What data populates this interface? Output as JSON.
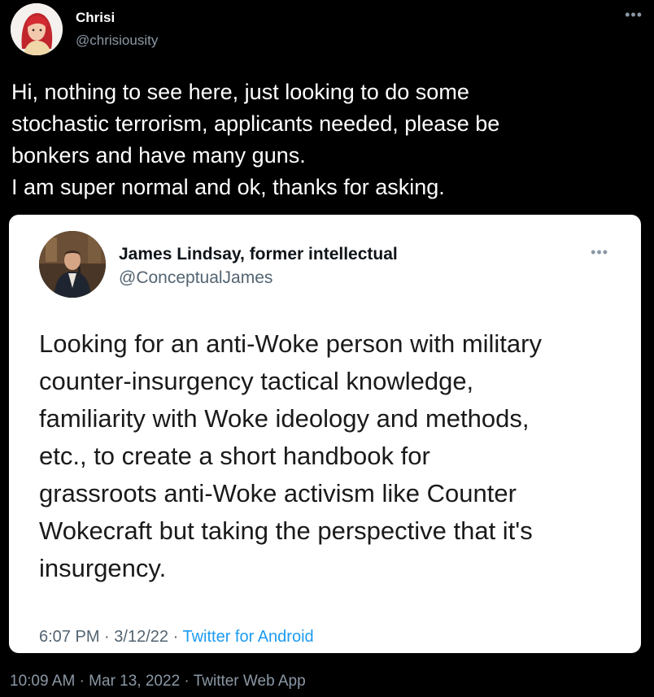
{
  "tweet": {
    "author_name": "Chrisi",
    "author_handle": "@chrisiousity",
    "text_lines": [
      "Hi, nothing to see here, just looking to do some",
      "stochastic terrorism, applicants needed, please be",
      "bonkers and have many guns.",
      "I am super normal and ok, thanks for asking."
    ],
    "more_icon": "more-dots-icon",
    "time": "10:09 AM",
    "separator": "·",
    "date": "Mar 13, 2022",
    "source": "Twitter Web App"
  },
  "quoted_tweet": {
    "author_name": "James Lindsay, former intellectual",
    "author_handle": "@ConceptualJames",
    "text_lines": [
      "Looking for an anti-Woke person with military",
      "counter-insurgency tactical knowledge,",
      "familiarity with Woke ideology and methods,",
      "etc., to create a short handbook for",
      "grassroots anti-Woke activism like Counter",
      "Wokecraft but taking the perspective that it's",
      "insurgency."
    ],
    "more_icon": "more-dots-icon",
    "time": "6:07 PM",
    "separator": "·",
    "date": "3/12/22",
    "source": "Twitter for Android"
  },
  "colors": {
    "background": "#000000",
    "card": "#ffffff",
    "link_blue": "#1d9bf0",
    "muted": "#8b98a5"
  }
}
